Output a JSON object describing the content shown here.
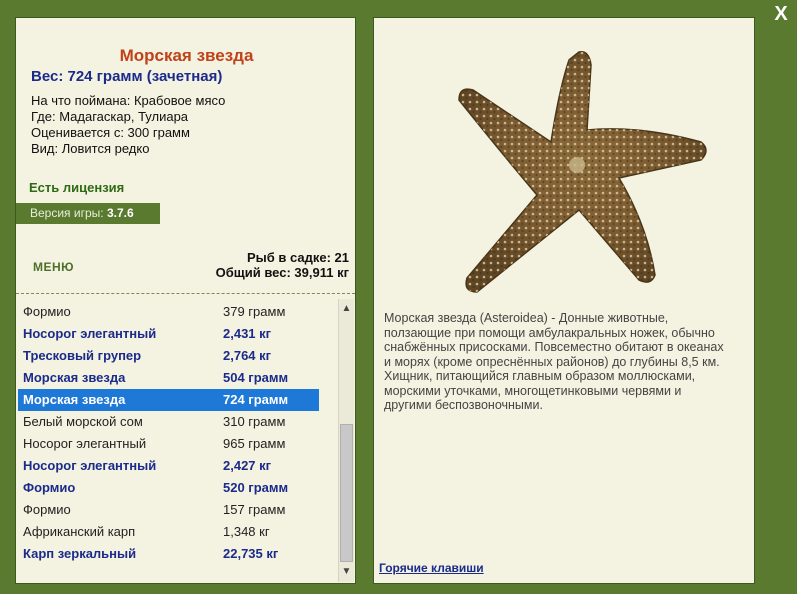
{
  "close_label": "X",
  "fish": {
    "title": "Морская звезда",
    "weight": "Вес: 724 грамм (зачетная)",
    "bait": "На что поймана: Крабовое мясо",
    "location": "Где: Мадагаскар, Тулиара",
    "value": "Оценивается с: 300 грамм",
    "rarity": "Вид: Ловится редко",
    "image_icon": "starfish-photo"
  },
  "license": "Есть лицензия",
  "version": {
    "label": "Версия игры:",
    "number": "3.7.6"
  },
  "menu_label": "МЕНЮ",
  "stats": {
    "fish_count": "Рыб в садке: 21",
    "total_weight": "Общий вес: 39,911 кг"
  },
  "catch_list": [
    {
      "name": "Формио",
      "weight": "379 грамм",
      "style": "normal"
    },
    {
      "name": "Носорог элегантный",
      "weight": "2,431 кг",
      "style": "best"
    },
    {
      "name": "Тресковый групер",
      "weight": "2,764 кг",
      "style": "best"
    },
    {
      "name": "Морская звезда",
      "weight": "504 грамм",
      "style": "best"
    },
    {
      "name": "Морская звезда",
      "weight": "724 грамм",
      "style": "selected"
    },
    {
      "name": "Белый морской сом",
      "weight": "310 грамм",
      "style": "normal"
    },
    {
      "name": "Носорог элегантный",
      "weight": "965 грамм",
      "style": "normal"
    },
    {
      "name": "Носорог элегантный",
      "weight": "2,427 кг",
      "style": "best"
    },
    {
      "name": "Формио",
      "weight": "520 грамм",
      "style": "best"
    },
    {
      "name": "Формио",
      "weight": "157 грамм",
      "style": "normal"
    },
    {
      "name": "Африканский карп",
      "weight": "1,348 кг",
      "style": "normal"
    },
    {
      "name": "Карп зеркальный",
      "weight": "22,735 кг",
      "style": "best"
    }
  ],
  "description": "Морская звезда (Asteroidea) - Донные животные, ползающие при помощи амбулакральных ножек, обычно снабжённых присосками. Повсеместно обитают в океанах и морях (кроме опреснённых районов) до глубины 8,5 км. Хищник, питающийся главным образом моллюсками, морскими уточками, многощетинковыми червями и другими беспозвоночными.",
  "hotkeys_label": "Горячие клавиши",
  "colors": {
    "frame": "#5a7a30",
    "panel": "#f4f2e0",
    "title": "#c0421a",
    "highlight": "#1b2b8c",
    "selected_row": "#1e78d8",
    "license": "#2f6a15"
  }
}
